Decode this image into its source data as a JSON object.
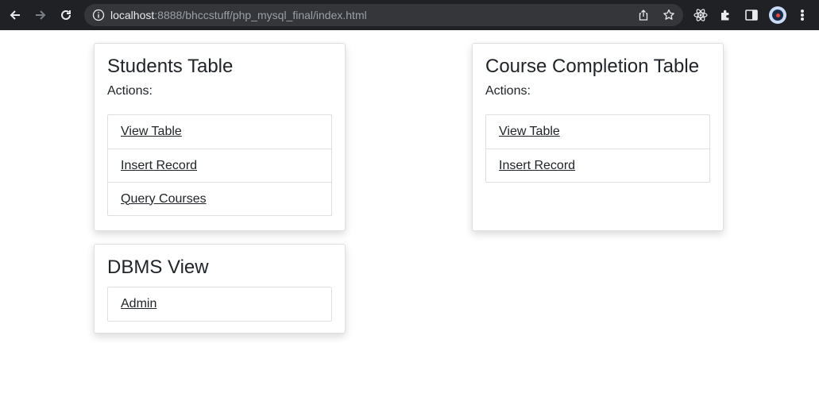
{
  "browser": {
    "url_host": "localhost",
    "url_rest": ":8888/bhccstuff/php_mysql_final/index.html"
  },
  "students": {
    "title": "Students Table",
    "actions_label": "Actions:",
    "links": [
      "View Table",
      "Insert Record",
      "Query Courses"
    ]
  },
  "course": {
    "title": "Course Completion Table",
    "actions_label": "Actions:",
    "links": [
      "View Table",
      "Insert Record"
    ]
  },
  "dbms": {
    "title": "DBMS View",
    "links": [
      "Admin"
    ]
  },
  "colors": {
    "toolbar": "#202124",
    "omnibox": "#35363a",
    "text": "#212529"
  }
}
